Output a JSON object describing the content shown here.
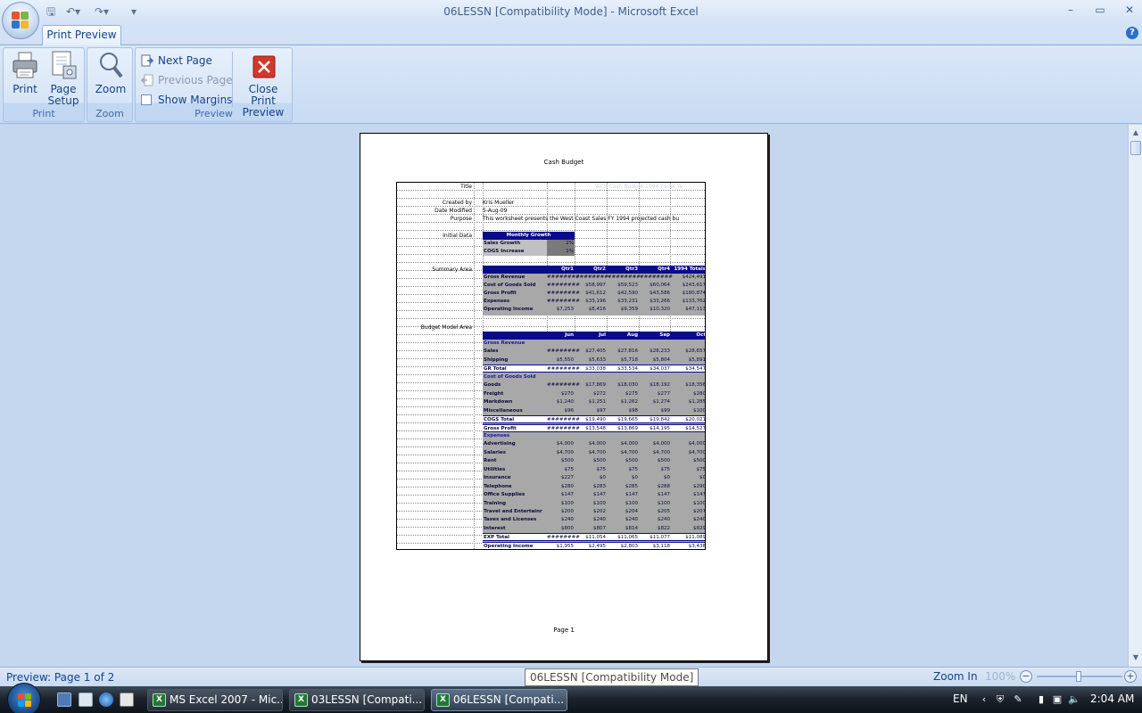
{
  "window": {
    "title": "06LESSN  [Compatibility Mode] - Microsoft Excel",
    "min": "–",
    "max": "▭",
    "close": "✕"
  },
  "ribbon": {
    "tab": "Print Preview",
    "help": "?",
    "groups": {
      "print": {
        "label": "Print",
        "print": "Print",
        "page_setup_1": "Page",
        "page_setup_2": "Setup"
      },
      "zoom": {
        "label": "Zoom",
        "zoom": "Zoom"
      },
      "preview": {
        "label": "Preview",
        "next_page": "Next Page",
        "previous_page": "Previous Page",
        "show_margins": "Show Margins",
        "close_1": "Close Print",
        "close_2": "Preview"
      }
    }
  },
  "page": {
    "title": "Cash Budget",
    "footer": "Page 1",
    "labels": {
      "title": "Title",
      "created_by": "Created by",
      "date_modified": "Date Modified",
      "purpose": "Purpose",
      "initial_data": "Initial Data",
      "summary_area": "Summary Area",
      "budget_model_area": "Budget Model Area"
    },
    "values": {
      "title": "WCS Cash Budget 1994 Fiscal Ye",
      "created_by": "Kris Mueller",
      "date_modified": "5-Aug-09",
      "purpose": "This worksheet presents the West Coast Sales FY 1994 projected cash bu"
    },
    "initial_data": {
      "header": "Monthly Growth",
      "rows": [
        [
          "Sales Growth",
          "2%"
        ],
        [
          "COGS Increase",
          "1%"
        ]
      ]
    },
    "summary": {
      "headers": [
        "Qtr1",
        "Qtr2",
        "Qtr3",
        "Qtr4",
        "1994 Totals"
      ],
      "rows": [
        [
          "Gross Revenue",
          "########",
          "########",
          "########",
          "########",
          "$424,491"
        ],
        [
          "Cost of Goods Sold",
          "########",
          "$58,997",
          "$59,523",
          "$60,064",
          "$243,617"
        ],
        [
          "Gross Profit",
          "########",
          "$41,612",
          "$42,590",
          "$43,586",
          "$180,874"
        ],
        [
          "Expenses",
          "########",
          "$33,196",
          "$33,231",
          "$33,266",
          "$133,762"
        ],
        [
          "Operating Income",
          "$7,253",
          "$8,416",
          "$9,359",
          "$10,320",
          "$47,113"
        ]
      ]
    },
    "budget": {
      "headers": [
        "Jun",
        "Jul",
        "Aug",
        "Sep",
        "Oct"
      ],
      "rows": [
        {
          "name": "Gross Revenue",
          "kind": "section",
          "v": [
            "",
            "",
            "",
            "",
            ""
          ]
        },
        {
          "name": "Sales",
          "kind": "row",
          "v": [
            "########",
            "$27,405",
            "$27,816",
            "$28,233",
            "$28,657"
          ]
        },
        {
          "name": "Shipping",
          "kind": "row",
          "v": [
            "$5,550",
            "$5,633",
            "$5,718",
            "$5,804",
            "$5,891"
          ]
        },
        {
          "name": "GR Total",
          "kind": "total",
          "v": [
            "########",
            "$33,038",
            "$33,534",
            "$34,037",
            "$34,547"
          ]
        },
        {
          "name": "Cost of Goods Sold",
          "kind": "section",
          "v": [
            "",
            "",
            "",
            "",
            ""
          ]
        },
        {
          "name": "Goods",
          "kind": "row",
          "v": [
            "########",
            "$17,869",
            "$18,030",
            "$18,192",
            "$18,356"
          ]
        },
        {
          "name": "Freight",
          "kind": "row",
          "v": [
            "$270",
            "$272",
            "$275",
            "$277",
            "$280"
          ]
        },
        {
          "name": "Markdown",
          "kind": "row",
          "v": [
            "$1,240",
            "$1,251",
            "$1,262",
            "$1,274",
            "$1,285"
          ]
        },
        {
          "name": "Miscellaneous",
          "kind": "row",
          "v": [
            "$96",
            "$97",
            "$98",
            "$99",
            "$100"
          ]
        },
        {
          "name": "COGS Total",
          "kind": "total",
          "v": [
            "########",
            "$19,490",
            "$19,665",
            "$19,842",
            "$20,021"
          ]
        },
        {
          "name": "Gross Profit",
          "kind": "total",
          "v": [
            "########",
            "$13,548",
            "$13,869",
            "$14,195",
            "$14,527"
          ]
        },
        {
          "name": "Expenses",
          "kind": "section",
          "v": [
            "",
            "",
            "",
            "",
            ""
          ]
        },
        {
          "name": "Advertising",
          "kind": "row",
          "v": [
            "$4,000",
            "$4,000",
            "$4,000",
            "$4,000",
            "$4,000"
          ]
        },
        {
          "name": "Salaries",
          "kind": "row",
          "v": [
            "$4,700",
            "$4,700",
            "$4,700",
            "$4,700",
            "$4,700"
          ]
        },
        {
          "name": "Rent",
          "kind": "row",
          "v": [
            "$500",
            "$500",
            "$500",
            "$500",
            "$500"
          ]
        },
        {
          "name": "Utilities",
          "kind": "row",
          "v": [
            "$75",
            "$75",
            "$75",
            "$75",
            "$75"
          ]
        },
        {
          "name": "Insurance",
          "kind": "row",
          "v": [
            "$227",
            "$0",
            "$0",
            "$0",
            "$0"
          ]
        },
        {
          "name": "Telephone",
          "kind": "row",
          "v": [
            "$280",
            "$283",
            "$285",
            "$288",
            "$290"
          ]
        },
        {
          "name": "Office Supplies",
          "kind": "row",
          "v": [
            "$147",
            "$147",
            "$147",
            "$147",
            "$147"
          ]
        },
        {
          "name": "Training",
          "kind": "row",
          "v": [
            "$100",
            "$100",
            "$100",
            "$100",
            "$100"
          ]
        },
        {
          "name": "Travel and Entertainr",
          "kind": "row",
          "v": [
            "$200",
            "$202",
            "$204",
            "$205",
            "$207"
          ]
        },
        {
          "name": "Taxes and Licenses",
          "kind": "row",
          "v": [
            "$240",
            "$240",
            "$240",
            "$240",
            "$240"
          ]
        },
        {
          "name": "Interest",
          "kind": "row",
          "v": [
            "$800",
            "$807",
            "$814",
            "$822",
            "$829"
          ]
        },
        {
          "name": "EXP Total",
          "kind": "total",
          "v": [
            "########",
            "$11,054",
            "$11,065",
            "$11,077",
            "$11,089"
          ]
        },
        {
          "name": "Operating Income",
          "kind": "total",
          "v": [
            "$1,955",
            "$2,495",
            "$2,803",
            "$3,118",
            "$3,438"
          ]
        }
      ]
    }
  },
  "status": {
    "text": "Preview: Page 1 of 2",
    "tooltip": "06LESSN  [Compatibility Mode]",
    "zoom_in": "Zoom In",
    "zoom_level": "100%",
    "zoom_minus": "−",
    "zoom_plus": "+"
  },
  "taskbar": {
    "tasks": [
      "MS Excel 2007 - Mic...",
      "03LESSN  [Compati...",
      "06LESSN  [Compati..."
    ],
    "lang": "EN",
    "clock": "2:04 AM"
  }
}
